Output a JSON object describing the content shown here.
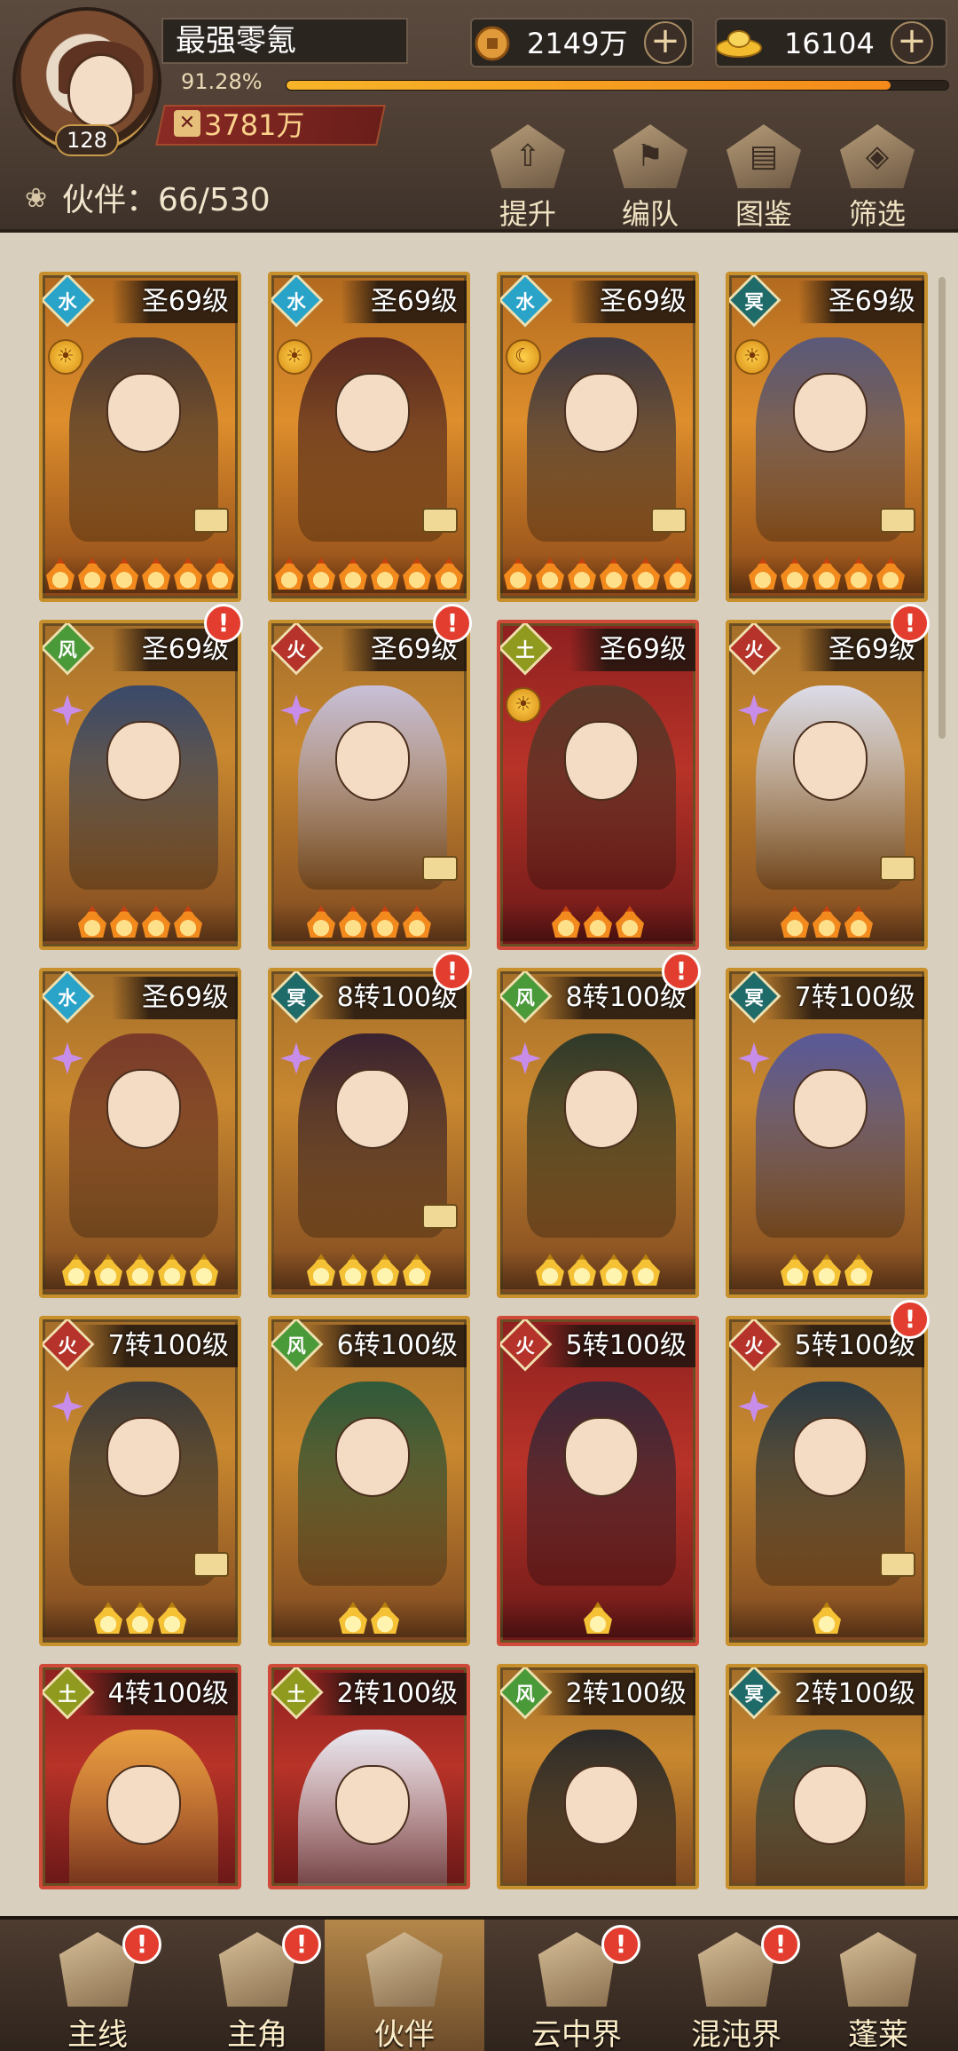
{
  "player": {
    "name": "最强零氪",
    "level": "128",
    "exp_percent_text": "91.28%",
    "exp_fraction": 0.9128,
    "power": "3781万"
  },
  "currencies": {
    "coins": "2149万",
    "gold_ingots": "16104"
  },
  "partners": {
    "count_label": "伙伴：66/530"
  },
  "top_actions": [
    "提升",
    "编队",
    "图鉴",
    "筛选"
  ],
  "cards": [
    {
      "level": "圣69级",
      "element": "water",
      "rarity": "orange",
      "flames": 6,
      "flame_color": "orange",
      "alert": false,
      "badge": "sun",
      "lock": true
    },
    {
      "level": "圣69级",
      "element": "water",
      "rarity": "orange",
      "flames": 6,
      "flame_color": "orange",
      "alert": false,
      "badge": "sun",
      "lock": true
    },
    {
      "level": "圣69级",
      "element": "water",
      "rarity": "orange",
      "flames": 6,
      "flame_color": "orange",
      "alert": false,
      "badge": "moon",
      "lock": true
    },
    {
      "level": "圣69级",
      "element": "shadow",
      "rarity": "orange",
      "flames": 5,
      "flame_color": "orange",
      "alert": false,
      "badge": "sun",
      "lock": true
    },
    {
      "level": "圣69级",
      "element": "wind",
      "rarity": "gold",
      "flames": 4,
      "flame_color": "orange",
      "alert": true,
      "badge": "star",
      "lock": false
    },
    {
      "level": "圣69级",
      "element": "fire",
      "rarity": "gold",
      "flames": 4,
      "flame_color": "orange",
      "alert": true,
      "badge": "star",
      "lock": true
    },
    {
      "level": "圣69级",
      "element": "earth",
      "rarity": "red",
      "flames": 3,
      "flame_color": "orange",
      "alert": false,
      "badge": "sun",
      "lock": false
    },
    {
      "level": "圣69级",
      "element": "fire",
      "rarity": "gold",
      "flames": 3,
      "flame_color": "orange",
      "alert": true,
      "badge": "star",
      "lock": true
    },
    {
      "level": "圣69级",
      "element": "water",
      "rarity": "gold",
      "flames": 5,
      "flame_color": "gold",
      "alert": false,
      "badge": "star",
      "lock": false
    },
    {
      "level": "8转100级",
      "element": "shadow",
      "rarity": "gold",
      "flames": 4,
      "flame_color": "gold",
      "alert": true,
      "badge": "star",
      "lock": true
    },
    {
      "level": "8转100级",
      "element": "wind",
      "rarity": "gold",
      "flames": 4,
      "flame_color": "gold",
      "alert": true,
      "badge": "star",
      "lock": false
    },
    {
      "level": "7转100级",
      "element": "shadow",
      "rarity": "gold",
      "flames": 3,
      "flame_color": "gold",
      "alert": false,
      "badge": "star",
      "lock": false
    },
    {
      "level": "7转100级",
      "element": "fire",
      "rarity": "gold",
      "flames": 3,
      "flame_color": "gold",
      "alert": false,
      "badge": "star",
      "lock": true
    },
    {
      "level": "6转100级",
      "element": "wind",
      "rarity": "gold",
      "flames": 2,
      "flame_color": "gold",
      "alert": false,
      "badge": "none",
      "lock": false
    },
    {
      "level": "5转100级",
      "element": "fire",
      "rarity": "red",
      "flames": 1,
      "flame_color": "gold",
      "alert": false,
      "badge": "none",
      "lock": false
    },
    {
      "level": "5转100级",
      "element": "fire",
      "rarity": "gold",
      "flames": 1,
      "flame_color": "gold",
      "alert": true,
      "badge": "star",
      "lock": true
    },
    {
      "level": "4转100级",
      "element": "earth",
      "rarity": "red",
      "flames": 0,
      "flame_color": "gold",
      "alert": false,
      "badge": "none",
      "lock": false
    },
    {
      "level": "2转100级",
      "element": "earth",
      "rarity": "red",
      "flames": 0,
      "flame_color": "gold",
      "alert": false,
      "badge": "none",
      "lock": false
    },
    {
      "level": "2转100级",
      "element": "wind",
      "rarity": "gold",
      "flames": 0,
      "flame_color": "gold",
      "alert": false,
      "badge": "none",
      "lock": false
    },
    {
      "level": "2转100级",
      "element": "shadow",
      "rarity": "gold",
      "flames": 0,
      "flame_color": "gold",
      "alert": false,
      "badge": "none",
      "lock": false
    }
  ],
  "element_colors": {
    "water": "#2aa3c8",
    "shadow": "#1f6b6a",
    "wind": "#4a9a3a",
    "fire": "#b5332a",
    "earth": "#8f9a1f"
  },
  "bottom_nav": [
    {
      "label": "主线",
      "alert": true,
      "active": false
    },
    {
      "label": "主角",
      "alert": true,
      "active": false
    },
    {
      "label": "伙伴",
      "alert": false,
      "active": true
    },
    {
      "label": "云中界",
      "alert": true,
      "active": false
    },
    {
      "label": "混沌界",
      "alert": true,
      "active": false
    },
    {
      "label": "蓬莱",
      "alert": false,
      "active": false
    }
  ],
  "alert_glyph": "!",
  "plus_glyph": "+"
}
